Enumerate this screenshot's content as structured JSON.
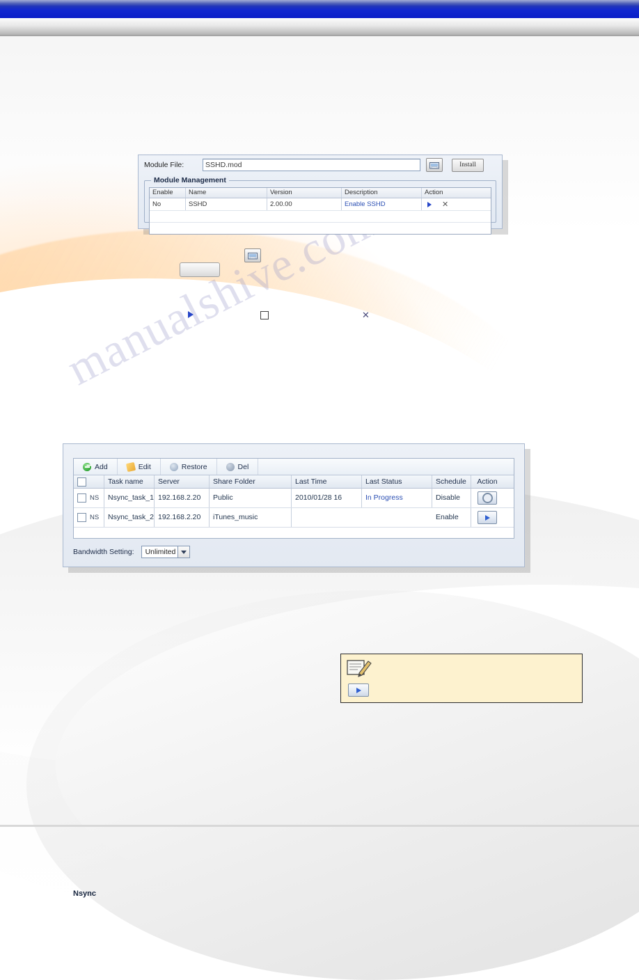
{
  "watermark": {
    "text": "manualshive.com"
  },
  "module_panel": {
    "file_label": "Module File:",
    "file_value": "SSHD.mod",
    "browse_icon": "folder-browse-icon",
    "install_label": "Install",
    "fieldset_legend": "Module Management",
    "table": {
      "headers": [
        "Enable",
        "Name",
        "Version",
        "Description",
        "Action"
      ],
      "rows": [
        {
          "enable": "No",
          "name": "SSHD",
          "version": "2.00.00",
          "description": "Enable SSHD",
          "action_run_icon": "play-triangle-icon",
          "action_delete_icon": "close-x-icon"
        }
      ]
    }
  },
  "callouts": {
    "browse_icon": "folder-browse-icon",
    "install_button": "install-button",
    "enable_icon": "play-triangle-icon",
    "disable_icon": "stop-square-icon",
    "remove_icon": "close-x-icon"
  },
  "nsync_panel": {
    "legend": "Nsync",
    "toolbar": [
      {
        "label": "Add",
        "icon": "add-icon"
      },
      {
        "label": "Edit",
        "icon": "edit-icon"
      },
      {
        "label": "Restore",
        "icon": "restore-icon"
      },
      {
        "label": "Del",
        "icon": "delete-icon"
      }
    ],
    "grid": {
      "headers": [
        "",
        "Task name",
        "Server",
        "Share Folder",
        "Last Time",
        "Last Status",
        "Schedule",
        "Action"
      ],
      "rows": [
        {
          "tag": "NS",
          "task_name": "Nsync_task_1",
          "server": "192.168.2.20",
          "share_folder": "Public",
          "last_time": "2010/01/28 16",
          "last_status": "In Progress",
          "schedule": "Disable",
          "action_icon": "gear-icon"
        },
        {
          "tag": "NS",
          "task_name": "Nsync_task_2",
          "server": "192.168.2.20",
          "share_folder": "iTunes_music",
          "last_time": "",
          "last_status": "",
          "schedule": "Enable",
          "action_icon": "play-triangle-icon"
        }
      ]
    },
    "bandwidth": {
      "label": "Bandwidth Setting:",
      "selected": "Unlimited",
      "caret_icon": "chevron-down-icon"
    }
  },
  "note_box": {
    "icon": "note-pencil-icon",
    "button_icon": "play-triangle-icon"
  },
  "colors": {
    "accent_blue": "#2646c8",
    "link_blue": "#2b4fb3",
    "note_bg": "#fdf2cf",
    "panel_bg": "#e8edf5"
  }
}
